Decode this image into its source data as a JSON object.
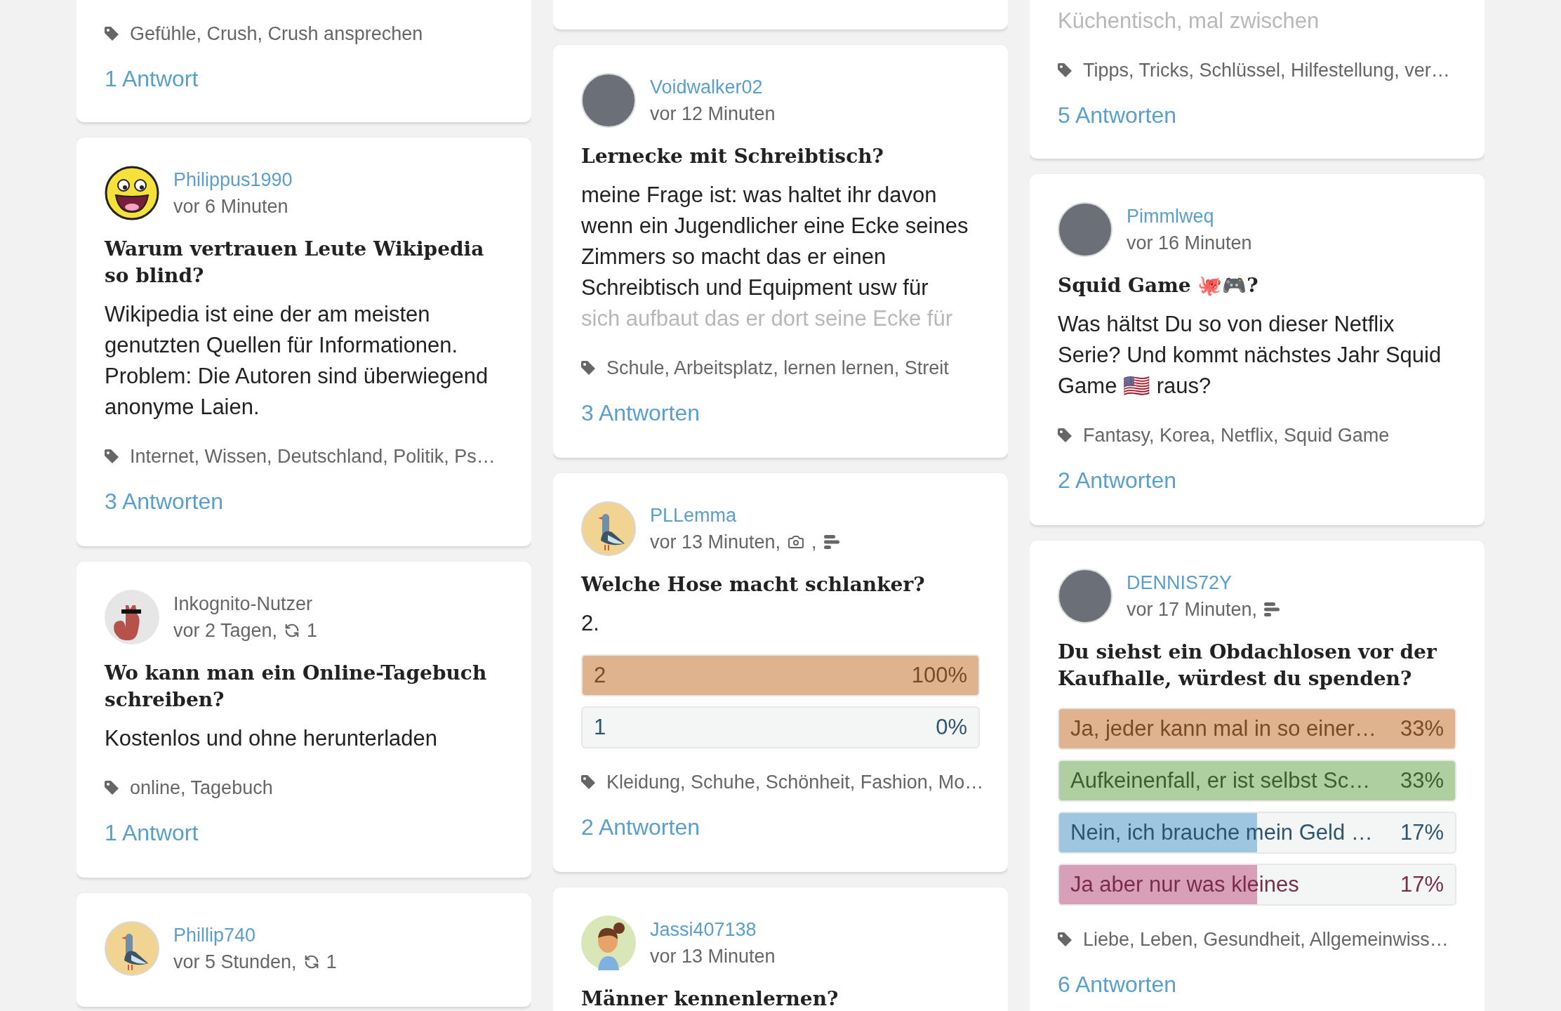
{
  "columns": [
    {
      "cards": [
        {
          "top_cut": true,
          "tags": "Gefühle, Crush, Crush ansprechen",
          "answers": "1 Antwort"
        },
        {
          "top_cut": false,
          "user": {
            "name": "Philippus1990",
            "anonymous": false,
            "avatar": {
              "kind": "smiley"
            }
          },
          "meta": [
            {
              "kind": "text",
              "text": "vor 6 Minuten"
            }
          ],
          "title": "Warum vertrauen Leute Wikipedia so blind?",
          "body": "Wikipedia ist eine der am meisten genutzten Quellen für Informationen. Problem: Die Autoren sind überwiegend anonyme Laien.",
          "tags": "Internet, Wissen, Deutschland, Politik, Ps…",
          "answers": "3 Antworten"
        },
        {
          "top_cut": false,
          "user": {
            "name": "Inkognito-Nutzer",
            "anonymous": true,
            "avatar": {
              "kind": "squirrel"
            }
          },
          "meta": [
            {
              "kind": "text",
              "text": "vor 2 Tagen,"
            },
            {
              "kind": "repost",
              "text": "1"
            }
          ],
          "title": "Wo kann man ein Online-Tagebuch schreiben?",
          "body": "Kostenlos und ohne herunterladen",
          "tags": "online, Tagebuch",
          "answers": "1 Antwort"
        },
        {
          "top_cut": false,
          "user": {
            "name": "Phillip740",
            "anonymous": false,
            "avatar": {
              "kind": "pigeon"
            }
          },
          "meta": [
            {
              "kind": "text",
              "text": "vor 5 Stunden,"
            },
            {
              "kind": "repost",
              "text": "1"
            }
          ]
        }
      ]
    },
    {
      "cards": [
        {
          "top_cut": true
        },
        {
          "top_cut": false,
          "user": {
            "name": "Voidwalker02",
            "anonymous": false,
            "avatar": {
              "kind": "photo"
            }
          },
          "meta": [
            {
              "kind": "text",
              "text": "vor 12 Minuten"
            }
          ],
          "title": "Lernecke mit Schreibtisch?",
          "body": "meine Frage ist: was haltet ihr davon wenn ein Jugendlicher eine Ecke seines Zimmers so macht das er einen Schreibtisch und Equipment usw für",
          "fade": "sich aufbaut das er dort seine Ecke für",
          "tags": "Schule, Arbeitsplatz, lernen lernen, Streit",
          "answers": "3 Antworten"
        },
        {
          "top_cut": false,
          "user": {
            "name": "PLLemma",
            "anonymous": false,
            "avatar": {
              "kind": "pigeon"
            }
          },
          "meta": [
            {
              "kind": "text",
              "text": "vor 13 Minuten,"
            },
            {
              "kind": "camera"
            },
            {
              "kind": "text",
              "text": ","
            },
            {
              "kind": "poll"
            }
          ],
          "title": "Welche Hose macht schlanker?",
          "body": "2.",
          "poll": [
            {
              "label": "2",
              "percent": "100%",
              "level": 1,
              "color": "#e0b38f"
            },
            {
              "label": "1",
              "percent": "0%",
              "level": 0
            }
          ],
          "tags": "Kleidung, Schuhe, Schönheit, Fashion, Mo…",
          "answers": "2 Antworten"
        },
        {
          "top_cut": false,
          "user": {
            "name": "Jassi407138",
            "anonymous": false,
            "avatar": {
              "kind": "girl"
            }
          },
          "meta": [
            {
              "kind": "text",
              "text": "vor 13 Minuten"
            }
          ],
          "title": "Männer kennenlernen?"
        }
      ]
    },
    {
      "cards": [
        {
          "top_cut": true,
          "fade": "Küchentisch, mal zwischen",
          "tags": "Tipps, Tricks, Schlüssel, Hilfestellung, ver…",
          "answers": "5 Antworten"
        },
        {
          "top_cut": false,
          "user": {
            "name": "Pimmlweq",
            "anonymous": false,
            "avatar": {
              "kind": "photo"
            }
          },
          "meta": [
            {
              "kind": "text",
              "text": "vor 16 Minuten"
            }
          ],
          "title": "Squid Game 🐙🎮?",
          "body": "Was hältst Du so von dieser Netflix Serie? Und kommt nächstes Jahr Squid Game 🇺🇸 raus?",
          "tags": "Fantasy, Korea, Netflix, Squid Game",
          "answers": "2 Antworten"
        },
        {
          "top_cut": false,
          "user": {
            "name": "DENNIS72Y",
            "anonymous": false,
            "avatar": {
              "kind": "photo"
            }
          },
          "meta": [
            {
              "kind": "text",
              "text": "vor 17 Minuten,"
            },
            {
              "kind": "poll"
            }
          ],
          "title": "Du siehst ein Obdachlosen vor der Kaufhalle, würdest du spenden?",
          "poll": [
            {
              "label": "Ja, jeder kann mal in so einer…",
              "percent": "33%",
              "level": 1,
              "color": "#e0b38f"
            },
            {
              "label": "Aufkeinenfall, er ist selbst Sc…",
              "percent": "33%",
              "level": 1,
              "color": "#aecf9f"
            },
            {
              "label": "Nein, ich brauche mein Geld …",
              "percent": "17%",
              "level": 0.5,
              "color": "#9ec6e0"
            },
            {
              "label": "Ja aber nur was kleines",
              "percent": "17%",
              "level": 0.5,
              "color": "#d8a0b8"
            }
          ],
          "tags": "Liebe, Leben, Gesundheit, Allgemeinwiss…",
          "answers": "6 Antworten"
        }
      ]
    }
  ]
}
